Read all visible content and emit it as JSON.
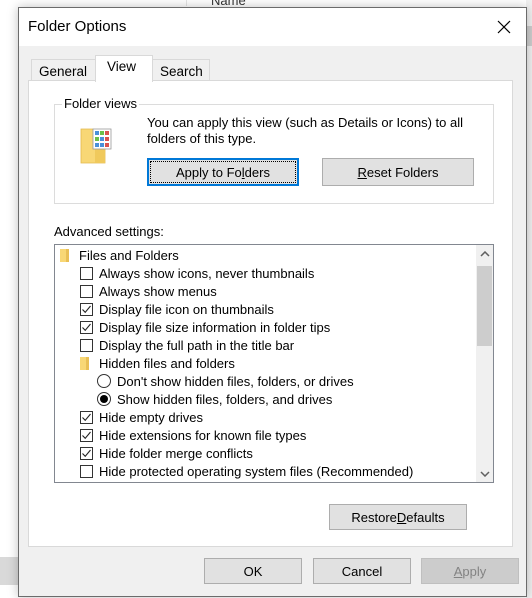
{
  "background": {
    "column_header": "Name"
  },
  "dialog": {
    "title": "Folder Options",
    "close_icon": "close-icon",
    "tabs": [
      {
        "label": "General",
        "active": false
      },
      {
        "label": "View",
        "active": true
      },
      {
        "label": "Search",
        "active": false
      }
    ],
    "folder_views": {
      "group_label": "Folder views",
      "description": "You can apply this view (such as Details or Icons) to all folders of this type.",
      "apply_button": {
        "pre": "Apply to Fo",
        "accel": "l",
        "post": "ders"
      },
      "reset_button": {
        "pre": "",
        "accel": "R",
        "post": "eset Folders"
      }
    },
    "advanced": {
      "label": "Advanced settings:",
      "items": [
        {
          "type": "folder",
          "label": "Files and Folders",
          "level": 0
        },
        {
          "type": "checkbox",
          "label": "Always show icons, never thumbnails",
          "checked": false,
          "level": 1
        },
        {
          "type": "checkbox",
          "label": "Always show menus",
          "checked": false,
          "level": 1
        },
        {
          "type": "checkbox",
          "label": "Display file icon on thumbnails",
          "checked": true,
          "level": 1
        },
        {
          "type": "checkbox",
          "label": "Display file size information in folder tips",
          "checked": true,
          "level": 1
        },
        {
          "type": "checkbox",
          "label": "Display the full path in the title bar",
          "checked": false,
          "level": 1
        },
        {
          "type": "folder",
          "label": "Hidden files and folders",
          "level": 1
        },
        {
          "type": "radio",
          "label": "Don't show hidden files, folders, or drives",
          "checked": false,
          "level": 2
        },
        {
          "type": "radio",
          "label": "Show hidden files, folders, and drives",
          "checked": true,
          "level": 2
        },
        {
          "type": "checkbox",
          "label": "Hide empty drives",
          "checked": true,
          "level": 1
        },
        {
          "type": "checkbox",
          "label": "Hide extensions for known file types",
          "checked": true,
          "level": 1
        },
        {
          "type": "checkbox",
          "label": "Hide folder merge conflicts",
          "checked": true,
          "level": 1
        },
        {
          "type": "checkbox",
          "label": "Hide protected operating system files (Recommended)",
          "checked": false,
          "level": 1
        }
      ],
      "scroll_position": 0.0
    },
    "restore_button": {
      "pre": "Restore ",
      "accel": "D",
      "post": "efaults"
    },
    "footer": {
      "ok": "OK",
      "cancel": "Cancel",
      "apply": {
        "pre": "",
        "accel": "A",
        "post": "pply",
        "disabled": true
      }
    }
  }
}
